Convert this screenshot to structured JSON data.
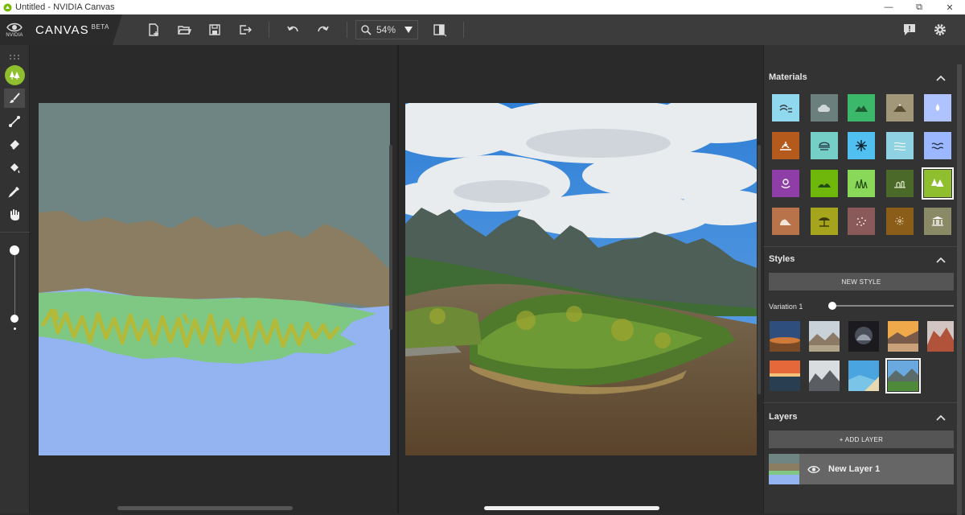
{
  "window": {
    "title": "Untitled - NVIDIA Canvas",
    "minimize": "—",
    "restore": "⧉",
    "close": "✕"
  },
  "brand": {
    "logo_text": "NVIDIA",
    "app_name": "CANVAS",
    "beta": "BETA"
  },
  "toolbar": {
    "zoom_value": "54%"
  },
  "materials": {
    "title": "Materials"
  },
  "styles": {
    "title": "Styles",
    "new_style": "NEW STYLE",
    "variation_label": "Variation 1",
    "variation_value": 0
  },
  "layers": {
    "title": "Layers",
    "add_layer": "+ ADD LAYER",
    "items": [
      {
        "name": "New Layer 1"
      }
    ]
  },
  "colors": {
    "accent": "#8fbf2f",
    "panel": "#333333",
    "toolbar": "#3c3c3c"
  }
}
